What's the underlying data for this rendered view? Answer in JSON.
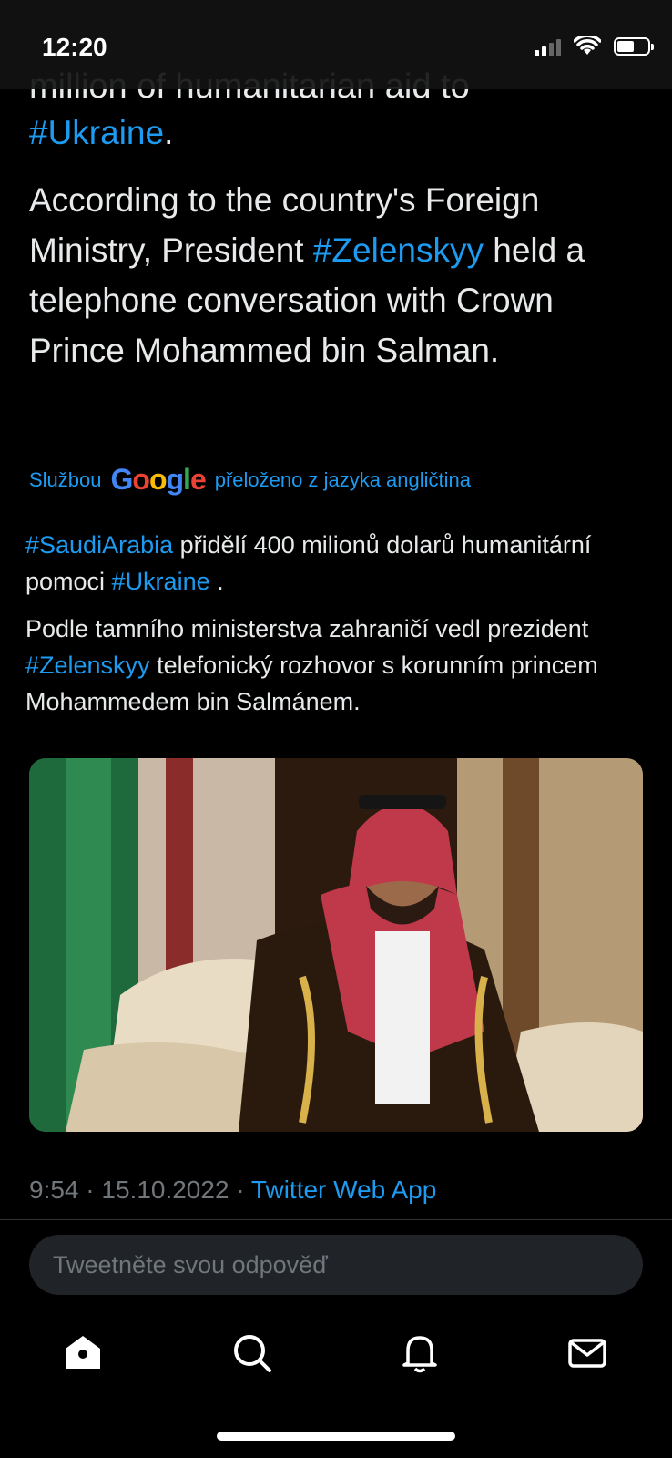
{
  "status_bar": {
    "time": "12:20",
    "battery_level": 0.6
  },
  "tweet": {
    "cut_line": "million of humanitarian aid to",
    "line1_hashtag": "#Ukraine",
    "line1_end": ".",
    "para2_start": "According to the country's Foreign Ministry, President ",
    "para2_hashtag": "#Zelenskyy",
    "para2_end": " held a telephone conversation with Crown Prince Mohammed bin Salman."
  },
  "translation": {
    "prefix": "Službou",
    "google": [
      "G",
      "o",
      "o",
      "g",
      "l",
      "e"
    ],
    "suffix": "přeloženo z jazyka angličtina",
    "p1_hashtag1": "#SaudiArabia",
    "p1_mid": " přidělí 400 milionů dolarů humanitární pomoci ",
    "p1_hashtag2": "#Ukraine",
    "p1_end": " .",
    "p2_start": "Podle tamního ministerstva zahraničí vedl prezident ",
    "p2_hashtag": "#Zelenskyy",
    "p2_end": " telefonický rozhovor s korunním princem Mohammedem bin Salmánem."
  },
  "meta": {
    "time": "9:54",
    "sep": " · ",
    "date": "15.10.2022",
    "app": "Twitter Web App"
  },
  "reply": {
    "placeholder": "Tweetněte svou odpověď"
  },
  "tabbar": [
    "home-icon",
    "search-icon",
    "notifications-icon",
    "messages-icon"
  ],
  "colors": {
    "accent": "#1d9bf0",
    "background": "#000000",
    "text": "#e7e9ea",
    "muted": "#71767b"
  }
}
